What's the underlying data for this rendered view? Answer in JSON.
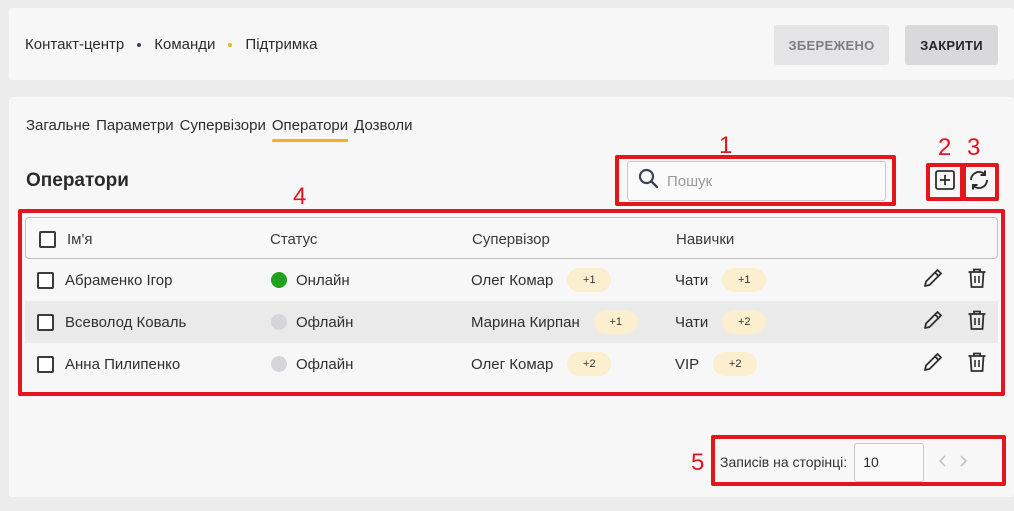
{
  "header": {
    "breadcrumb": [
      {
        "label": "Контакт-центр"
      },
      {
        "label": "Команди",
        "dot_color": "#3b3f5a"
      },
      {
        "label": "Підтримка",
        "dot_color": "#f2b41e"
      }
    ],
    "saved_label": "ЗБЕРЕЖЕНО",
    "close_label": "ЗАКРИТИ"
  },
  "tabs": [
    {
      "label": "Загальне"
    },
    {
      "label": "Параметри"
    },
    {
      "label": "Супервізори"
    },
    {
      "label": "Оператори",
      "active": true
    },
    {
      "label": "Дозволи"
    }
  ],
  "section_title": "Оператори",
  "search": {
    "placeholder": "Пошук",
    "value": "",
    "icon": "search-icon"
  },
  "toolbar": {
    "add_icon": "plus-square-icon",
    "refresh_icon": "refresh-icon"
  },
  "table": {
    "columns": [
      "Ім'я",
      "Статус",
      "Супервізор",
      "Навички"
    ],
    "rows": [
      {
        "name": "Абраменко Ігор",
        "status": "Онлайн",
        "status_color": "#1fa01f",
        "supervisor": "Олег Комар",
        "supervisor_extra": "+1",
        "skill": "Чати",
        "skill_extra": "+1"
      },
      {
        "name": "Всеволод Коваль",
        "status": "Офлайн",
        "status_color": "#d5d5da",
        "supervisor": "Марина Кирпан",
        "supervisor_extra": "+1",
        "skill": "Чати",
        "skill_extra": "+2"
      },
      {
        "name": "Анна Пилипенко",
        "status": "Офлайн",
        "status_color": "#d5d5da",
        "supervisor": "Олег Комар",
        "supervisor_extra": "+2",
        "skill": "VIP",
        "skill_extra": "+2"
      }
    ]
  },
  "pagination": {
    "label": "Записів на сторінці:",
    "page_size": "10"
  },
  "annotations": [
    "1",
    "2",
    "3",
    "4",
    "5"
  ],
  "colors": {
    "accent": "#f2b41e",
    "annotation": "#e3151f",
    "online": "#1fa01f",
    "offline": "#d5d5da",
    "pill": "#fbefd0"
  }
}
